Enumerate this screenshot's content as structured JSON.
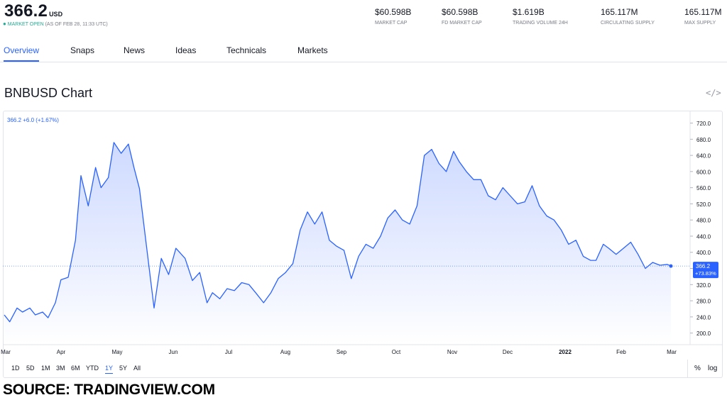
{
  "header": {
    "price": "366.2",
    "currency": "USD",
    "status_label": "MARKET OPEN",
    "status_time": "(AS OF FEB 28, 11:33 UTC)",
    "stats": [
      {
        "value": "$60.598B",
        "label": "MARKET CAP"
      },
      {
        "value": "$60.598B",
        "label": "FD MARKET CAP"
      },
      {
        "value": "$1.619B",
        "label": "TRADING VOLUME 24H"
      },
      {
        "value": "165.117M",
        "label": "CIRCULATING SUPPLY"
      },
      {
        "value": "165.117M",
        "label": "MAX SUPPLY"
      }
    ]
  },
  "tabs": [
    {
      "label": "Overview",
      "active": true
    },
    {
      "label": "Snaps",
      "active": false
    },
    {
      "label": "News",
      "active": false
    },
    {
      "label": "Ideas",
      "active": false
    },
    {
      "label": "Technicals",
      "active": false
    },
    {
      "label": "Markets",
      "active": false
    }
  ],
  "chart_title": "BNBUSD Chart",
  "embed_icon": "code-embed-icon",
  "ranges": [
    {
      "label": "1D",
      "active": false
    },
    {
      "label": "5D",
      "active": false
    },
    {
      "label": "1M",
      "active": false
    },
    {
      "label": "3M",
      "active": false
    },
    {
      "label": "6M",
      "active": false
    },
    {
      "label": "YTD",
      "active": false
    },
    {
      "label": "1Y",
      "active": true
    },
    {
      "label": "5Y",
      "active": false
    },
    {
      "label": "All",
      "active": false
    }
  ],
  "scale_buttons": [
    "%",
    "log"
  ],
  "source": "SOURCE: TRADINGVIEW.COM",
  "colors": {
    "line": "#2962ff",
    "accent": "#2962ff",
    "status": "#22ab94",
    "fill_top": "#c9d6ff",
    "fill_bottom": "#ffffff"
  },
  "chart_data": {
    "type": "area",
    "series": [
      {
        "name": "BNBUSD",
        "values": []
      }
    ],
    "legend_text": "366.2  +6.0 (+1.67%)",
    "last_label": "366.2",
    "last_change": "+73.83%",
    "xlabels": [
      "Mar",
      "Apr",
      "May",
      "Jun",
      "Jul",
      "Aug",
      "Sep",
      "Oct",
      "Nov",
      "Dec",
      "2022",
      "Feb",
      "Mar"
    ],
    "yticks": [
      200,
      240,
      280,
      320,
      360,
      400,
      440,
      480,
      520,
      560,
      600,
      640,
      680,
      720
    ],
    "ylim": [
      173,
      735
    ],
    "x": [
      "2021-02-28",
      "2021-03-03",
      "2021-03-07",
      "2021-03-10",
      "2021-03-14",
      "2021-03-17",
      "2021-03-21",
      "2021-03-24",
      "2021-03-28",
      "2021-03-31",
      "2021-04-04",
      "2021-04-08",
      "2021-04-11",
      "2021-04-15",
      "2021-04-19",
      "2021-04-22",
      "2021-04-26",
      "2021-04-29",
      "2021-05-03",
      "2021-05-07",
      "2021-05-10",
      "2021-05-13",
      "2021-05-17",
      "2021-05-21",
      "2021-05-25",
      "2021-05-29",
      "2021-06-02",
      "2021-06-07",
      "2021-06-11",
      "2021-06-15",
      "2021-06-19",
      "2021-06-22",
      "2021-06-26",
      "2021-06-30",
      "2021-07-04",
      "2021-07-08",
      "2021-07-12",
      "2021-07-16",
      "2021-07-20",
      "2021-07-24",
      "2021-07-28",
      "2021-08-01",
      "2021-08-05",
      "2021-08-09",
      "2021-08-13",
      "2021-08-17",
      "2021-08-21",
      "2021-08-25",
      "2021-08-29",
      "2021-09-02",
      "2021-09-06",
      "2021-09-10",
      "2021-09-14",
      "2021-09-18",
      "2021-09-22",
      "2021-09-26",
      "2021-09-30",
      "2021-10-04",
      "2021-10-08",
      "2021-10-12",
      "2021-10-16",
      "2021-10-20",
      "2021-10-24",
      "2021-10-28",
      "2021-11-01",
      "2021-11-04",
      "2021-11-08",
      "2021-11-12",
      "2021-11-16",
      "2021-11-20",
      "2021-11-24",
      "2021-11-28",
      "2021-12-02",
      "2021-12-06",
      "2021-12-10",
      "2021-12-14",
      "2021-12-18",
      "2021-12-22",
      "2021-12-26",
      "2021-12-30",
      "2022-01-03",
      "2022-01-07",
      "2022-01-11",
      "2022-01-15",
      "2022-01-18",
      "2022-01-22",
      "2022-01-25",
      "2022-01-29",
      "2022-02-02",
      "2022-02-06",
      "2022-02-10",
      "2022-02-14",
      "2022-02-18",
      "2022-02-22",
      "2022-02-26",
      "2022-02-28"
    ],
    "y": [
      245,
      228,
      262,
      252,
      262,
      245,
      252,
      238,
      275,
      332,
      338,
      430,
      590,
      515,
      610,
      560,
      585,
      672,
      645,
      668,
      610,
      558,
      410,
      262,
      385,
      345,
      410,
      385,
      330,
      350,
      275,
      300,
      285,
      310,
      305,
      325,
      320,
      298,
      275,
      300,
      335,
      350,
      372,
      455,
      500,
      470,
      500,
      430,
      415,
      405,
      335,
      390,
      420,
      410,
      440,
      485,
      505,
      480,
      470,
      515,
      640,
      655,
      620,
      600,
      650,
      625,
      600,
      580,
      580,
      540,
      530,
      560,
      540,
      520,
      525,
      565,
      515,
      490,
      480,
      455,
      420,
      430,
      390,
      380,
      380,
      420,
      410,
      395,
      410,
      425,
      395,
      360,
      375,
      368,
      370,
      366
    ]
  }
}
